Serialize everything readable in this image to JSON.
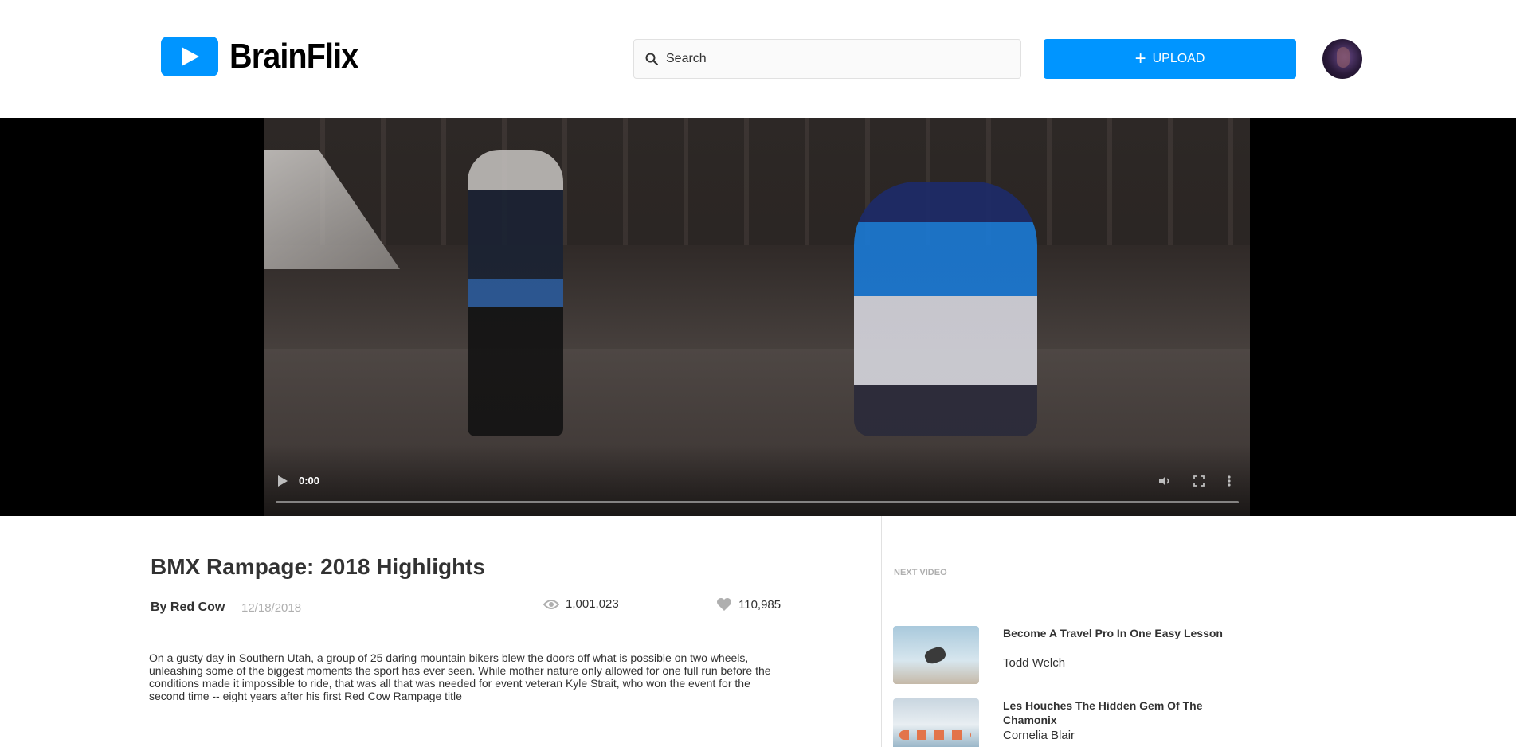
{
  "header": {
    "brand": "BrainFlix",
    "search_placeholder": "Search",
    "upload_label": "UPLOAD"
  },
  "player": {
    "time": "0:00",
    "progress": 0
  },
  "video": {
    "title": "BMX Rampage: 2018 Highlights",
    "channel": "By Red Cow",
    "date": "12/18/2018",
    "views": "1,001,023",
    "likes": "110,985",
    "description": "On a gusty day in Southern Utah, a group of 25 daring mountain bikers blew the doors off what is possible on two wheels, unleashing some of the biggest moments the sport has ever seen. While mother nature only allowed for one full run before the conditions made it impossible to ride, that was all that was needed for event veteran Kyle Strait, who won the event for the second time -- eight years after his first Red Cow Rampage title"
  },
  "next_videos": {
    "label": "NEXT VIDEO",
    "items": [
      {
        "title": "Become A Travel Pro In One Easy Lesson",
        "author": "Todd Welch"
      },
      {
        "title": "Les Houches The Hidden Gem Of The Chamonix",
        "author": "Cornelia Blair"
      }
    ]
  },
  "colors": {
    "accent": "#0095ff",
    "text": "#323232",
    "muted": "#afafaf",
    "border": "#e1e1e1"
  }
}
